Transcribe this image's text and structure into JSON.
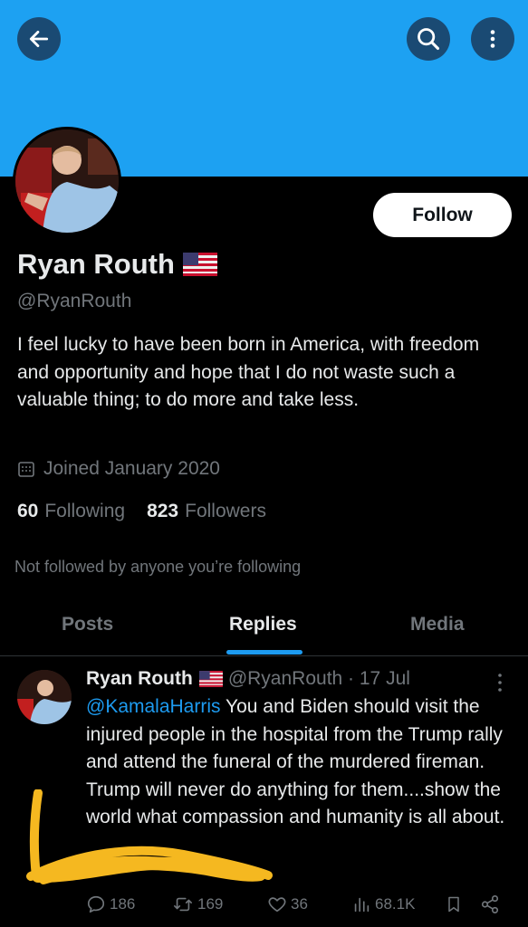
{
  "profile": {
    "name": "Ryan Routh",
    "handle": "@RyanRouth",
    "bio": "I feel lucky to have been born in America, with freedom and opportunity and hope that I do not waste such a valuable thing; to do more and take less.",
    "joined": "Joined January 2020",
    "following_count": "60",
    "following_label": "Following",
    "followers_count": "823",
    "followers_label": "Followers",
    "not_followed": "Not followed by anyone you’re following",
    "follow_label": "Follow"
  },
  "tabs": [
    {
      "label": "Posts"
    },
    {
      "label": "Replies"
    },
    {
      "label": "Media"
    }
  ],
  "tweet": {
    "name": "Ryan Routh",
    "handle_date": "@RyanRouth · 17 Jul",
    "mention": "@KamalaHarris",
    "text": " You and Biden should visit the injured people in the hospital from the Trump rally and attend the funeral of the murdered fireman. Trump will never do anything for them....show the world what compassion and humanity is all about.",
    "replies": "186",
    "retweets": "169",
    "likes": "36",
    "views": "68.1K"
  },
  "colors": {
    "banner": "#1da1f2",
    "accent": "#1d9bf0",
    "scribble": "#f5b820"
  }
}
